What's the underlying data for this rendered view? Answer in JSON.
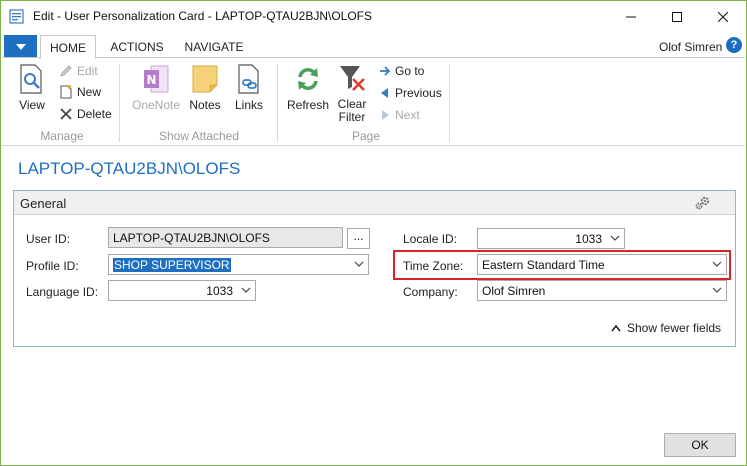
{
  "window": {
    "title": "Edit - User Personalization Card - LAPTOP-QTAU2BJN\\OLOFS"
  },
  "ribbon": {
    "tabs": [
      "HOME",
      "ACTIONS",
      "NAVIGATE"
    ],
    "user": "Olof Simren",
    "help": "?",
    "groups": {
      "manage": {
        "label": "Manage",
        "view": "View",
        "edit": "Edit",
        "new": "New",
        "delete": "Delete"
      },
      "show_attached": {
        "label": "Show Attached",
        "onenote": "OneNote",
        "notes": "Notes",
        "links": "Links"
      },
      "page": {
        "label": "Page",
        "refresh": "Refresh",
        "clear_filter_line1": "Clear",
        "clear_filter_line2": "Filter",
        "go_to": "Go to",
        "previous": "Previous",
        "next": "Next"
      }
    }
  },
  "page": {
    "title": "LAPTOP-QTAU2BJN\\OLOFS"
  },
  "general": {
    "header": "General",
    "fields": {
      "user_id": {
        "label": "User ID:",
        "value": "LAPTOP-QTAU2BJN\\OLOFS",
        "assist": "..."
      },
      "profile_id": {
        "label": "Profile ID:",
        "value": "SHOP SUPERVISOR"
      },
      "language_id": {
        "label": "Language ID:",
        "value": "1033"
      },
      "locale_id": {
        "label": "Locale ID:",
        "value": "1033"
      },
      "time_zone": {
        "label": "Time Zone:",
        "value": "Eastern Standard Time"
      },
      "company": {
        "label": "Company:",
        "value": "Olof Simren"
      }
    },
    "show_fewer": "Show fewer fields"
  },
  "footer": {
    "ok": "OK"
  },
  "colors": {
    "accent": "#1e6fc2",
    "highlight": "#d9232d",
    "window_border": "#7fb24a"
  }
}
